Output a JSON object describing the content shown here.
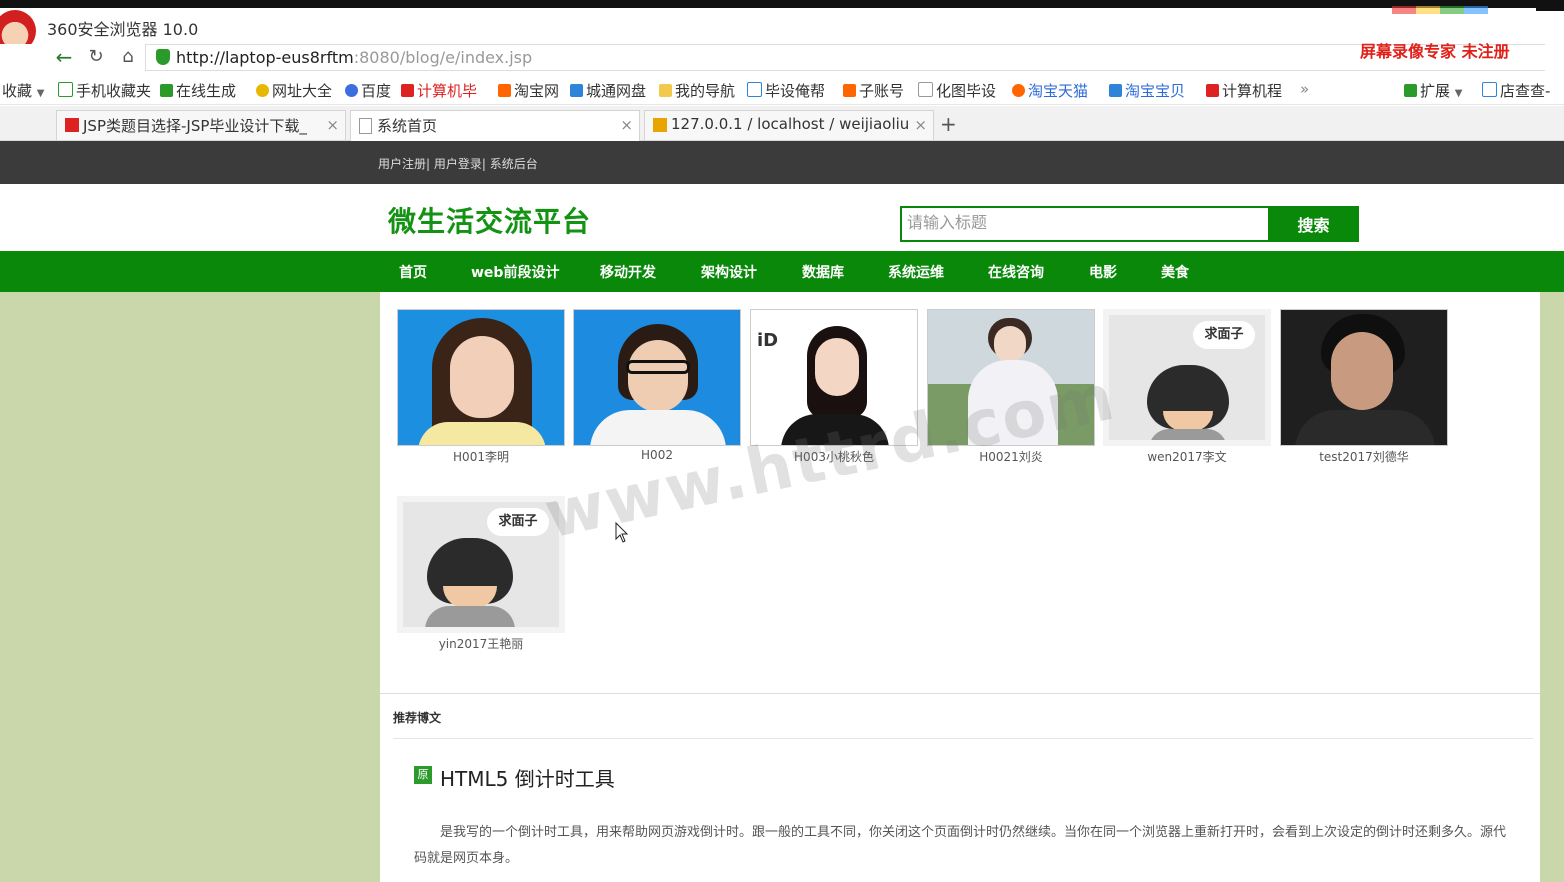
{
  "browser": {
    "app_title": "360安全浏览器 10.0",
    "url_host": "http://laptop-eus8rftm",
    "url_path": ":8080/blog/e/index.jsp",
    "recorder_text": "屏幕录像专家  未注册",
    "bookmarks": [
      "收藏",
      "手机收藏夹",
      "在线生成",
      "网址大全",
      "百度",
      "计算机毕",
      "淘宝网",
      "城通网盘",
      "我的导航",
      "毕设俺帮",
      "子账号",
      "化图毕设",
      "淘宝天猫",
      "淘宝宝贝",
      "计算机程",
      "»",
      "扩展",
      "店查查-"
    ],
    "tabs": [
      {
        "label": "JSP类题目选择-JSP毕业设计下载_"
      },
      {
        "label": "系统首页"
      },
      {
        "label": "127.0.0.1 / localhost / weijiaoliu"
      }
    ],
    "new_tab": "+"
  },
  "site": {
    "top_links": "用户注册| 用户登录| 系统后台",
    "title": "微生活交流平台",
    "search_placeholder": "请输入标题",
    "search_button": "搜索",
    "nav": [
      "首页",
      "web前段设计",
      "移动开发",
      "架构设计",
      "数据库",
      "系统运维",
      "在线咨询",
      "电影",
      "美食"
    ]
  },
  "members": [
    {
      "name": "H001李明",
      "photo": "woman-blue-bg-photo"
    },
    {
      "name": "H002",
      "photo": "woman-glasses-photo"
    },
    {
      "name": "H003小桃秋色",
      "photo": "id-photo"
    },
    {
      "name": "H0021刘炎",
      "photo": "costume-photo"
    },
    {
      "name": "wen2017李文",
      "photo": "cartoon-avatar",
      "bubble": "求面子"
    },
    {
      "name": "test2017刘德华",
      "photo": "man-dark-photo"
    },
    {
      "name": "yin2017王艳丽",
      "photo": "cartoon-avatar",
      "bubble": "求面子"
    }
  ],
  "recommend": {
    "label": "推荐博文",
    "badge": "原",
    "post_title": "HTML5 倒计时工具",
    "post_body": "是我写的一个倒计时工具，用来帮助网页游戏倒计时。跟一般的工具不同，你关闭这个页面倒计时仍然继续。当你在同一个浏览器上重新打开时，会看到上次设定的倒计时还剩多久。源代码就是网页本身。"
  },
  "watermark": "www.httrd.com"
}
